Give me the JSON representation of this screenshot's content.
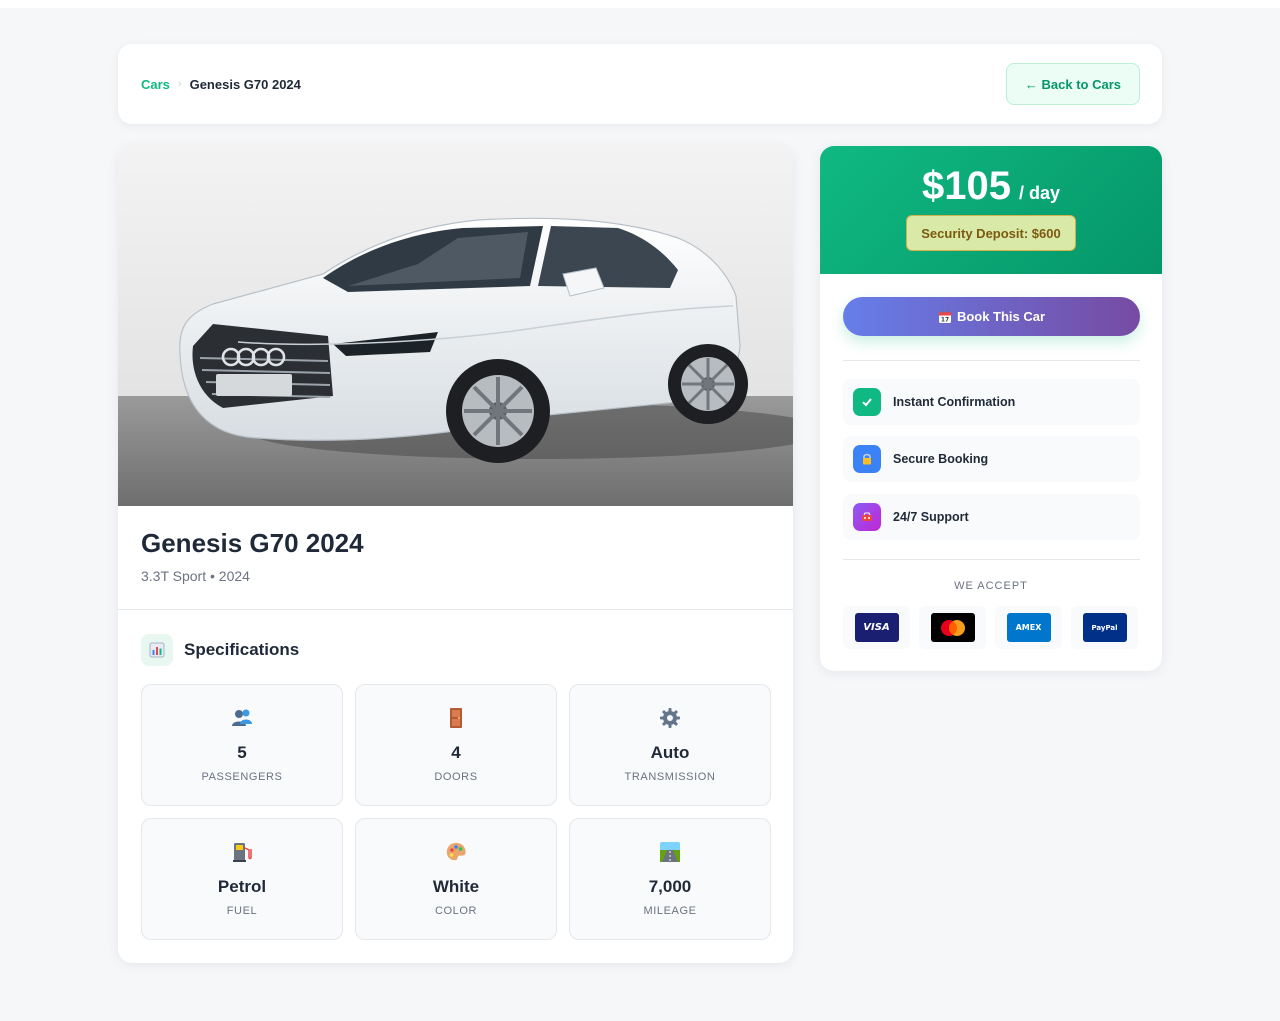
{
  "breadcrumb": {
    "root": "Cars",
    "separator": "›",
    "current": "Genesis G70 2024"
  },
  "header": {
    "back_label": "← Back to Cars"
  },
  "car": {
    "image_alt": "White sedan on grey floor",
    "title": "Genesis G70 2024",
    "subtitle": "3.3T Sport • 2024"
  },
  "specs": {
    "heading": "Specifications",
    "items": [
      {
        "value": "5",
        "label": "PASSENGERS",
        "icon": "passengers-icon"
      },
      {
        "value": "4",
        "label": "DOORS",
        "icon": "door-icon"
      },
      {
        "value": "Auto",
        "label": "TRANSMISSION",
        "icon": "gear-icon"
      },
      {
        "value": "Petrol",
        "label": "FUEL",
        "icon": "fuel-pump-icon"
      },
      {
        "value": "White",
        "label": "COLOR",
        "icon": "palette-icon"
      },
      {
        "value": "7,000",
        "label": "MILEAGE",
        "icon": "road-icon"
      }
    ]
  },
  "pricing": {
    "amount": "$105",
    "unit": "/ day",
    "deposit": "Security Deposit: $600",
    "book_label": "Book This Car"
  },
  "features": [
    {
      "label": "Instant Confirmation",
      "icon": "check-icon",
      "color": "#10b981"
    },
    {
      "label": "Secure Booking",
      "icon": "lock-icon",
      "color": "#3b82f6"
    },
    {
      "label": "24/7 Support",
      "icon": "support-icon",
      "color": "#8b5cf6"
    }
  ],
  "payments": {
    "label": "WE ACCEPT",
    "methods": [
      {
        "name": "VISA",
        "color": "#1a1f71"
      },
      {
        "name": "Mastercard",
        "color": "#000000"
      },
      {
        "name": "AMEX",
        "color": "#0077cc"
      },
      {
        "name": "PayPal",
        "color": "#003087"
      }
    ]
  },
  "colors": {
    "accent": "#10b981",
    "accent_dark": "#059669",
    "book_start": "#667eea",
    "book_end": "#764ba2"
  }
}
